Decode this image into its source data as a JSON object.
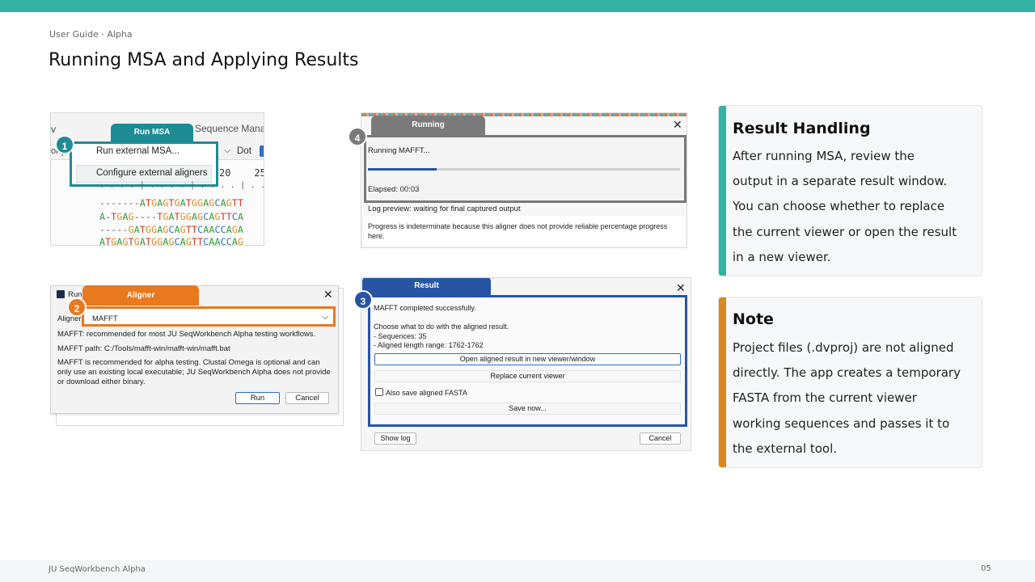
{
  "header": {
    "breadcrumb": "User Guide · Alpha",
    "title": "Running MSA and Applying Results"
  },
  "footer": {
    "product": "JU SeqWorkbench Alpha",
    "page": "05"
  },
  "colors": {
    "teal": "#33b3a3",
    "orange": "#e8791f",
    "blue": "#2854a4",
    "gray": "#7a7a7a",
    "dark_teal": "#1e8c95"
  },
  "step1": {
    "badge": "1",
    "tab": "Run MSA",
    "bg_left": "v",
    "bg_right": "Sequence Mana",
    "bg_row2_left": "ohyl",
    "dot_label": "Dot",
    "ruler": "20    25",
    "menu_item_1": "Run external MSA...",
    "menu_item_2": "Configure external aligners",
    "sequences": [
      "-------ATGAGTGATGGAGCAGTT",
      "A-TGAG----TGATGGAGCAGTTCA",
      "-----GATGGAGCAGTTCAACCAGA",
      "ATGAGTGATGGAGCAGTTCAACCAG"
    ]
  },
  "step4": {
    "badge": "4",
    "tab": "Running",
    "status": "Running MAFFT...",
    "progress": 0.22,
    "elapsed": "Elapsed: 00:03",
    "log_preview": "Log preview: waiting for final captured output",
    "note_line1": "Progress is indeterminate because this aligner does not provide reliable percentage progress",
    "note_line2": "here."
  },
  "step2": {
    "badge": "2",
    "tab": "Aligner",
    "window_title": "Run",
    "aligner_label": "Aligner",
    "aligner_value": "MAFFT",
    "info1": "MAFFT: recommended for most JU SeqWorkbench Alpha testing workflows.",
    "info2": "MAFFT path: C:/Tools/mafft-win/mafft-win/mafft.bat",
    "info3a": "MAFFT is recommended for alpha testing. Clustal Omega is optional and can",
    "info3b": "only use an existing local executable; JU SeqWorkbench Alpha does not provide",
    "info3c": "or download either binary.",
    "run": "Run",
    "cancel": "Cancel"
  },
  "step3": {
    "badge": "3",
    "tab": "Result",
    "completed": "MAFFT completed successfully.",
    "choose": "Choose what to do with the aligned result.",
    "sequences": "- Sequences: 35",
    "length": "- Aligned length range: 1762-1762",
    "open_btn": "Open aligned result in new viewer/window",
    "replace_btn": "Replace current viewer",
    "also_save": "Also save aligned FASTA",
    "save_now": "Save now...",
    "show_log": "Show log",
    "cancel": "Cancel"
  },
  "cards": [
    {
      "title": "Result Handling",
      "lines": [
        "After running MSA, review the",
        "output in a separate result window.",
        "You can choose whether to replace",
        "the current viewer or open the result",
        "in a new viewer."
      ]
    },
    {
      "title": "Note",
      "lines": [
        "Project files (.dvproj) are not aligned",
        "directly. The app creates a temporary",
        "FASTA from the current viewer",
        "working sequences and passes it to",
        "the external tool."
      ]
    }
  ]
}
